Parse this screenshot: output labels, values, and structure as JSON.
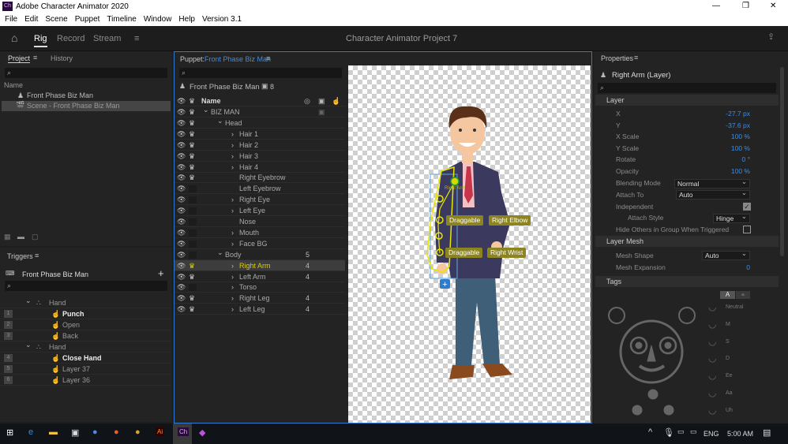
{
  "window": {
    "app_icon": "Ch",
    "title": "Adobe Character Animator 2020",
    "minimize": "—",
    "maximize": "❐",
    "close": "✕"
  },
  "menu": [
    "File",
    "Edit",
    "Scene",
    "Puppet",
    "Timeline",
    "Window",
    "Help",
    "Version 3.1"
  ],
  "header": {
    "workspaces": [
      "Rig",
      "Record",
      "Stream"
    ],
    "active": "Rig",
    "project_title": "Character Animator Project 7"
  },
  "project": {
    "tabs": [
      "Project",
      "History"
    ],
    "column": "Name",
    "items": [
      "Front Phase Biz Man",
      "Scene - Front Phase Biz Man"
    ]
  },
  "triggers": {
    "title": "Triggers",
    "puppet": "Front Phase Biz Man",
    "add": "+",
    "groups": [
      {
        "name": "Hand",
        "items": [
          {
            "key": "1",
            "label": "Punch",
            "active": true
          },
          {
            "key": "2",
            "label": "Open"
          },
          {
            "key": "3",
            "label": "Back"
          }
        ]
      },
      {
        "name": "Hand",
        "items": [
          {
            "key": "4",
            "label": "Close Hand",
            "active": true
          },
          {
            "key": "5",
            "label": "Layer 37"
          },
          {
            "key": "6",
            "label": "Layer 36"
          }
        ]
      }
    ]
  },
  "puppet": {
    "label": "Puppet:",
    "name": "Front Phase Biz Man",
    "title": "Front Phase Biz Man",
    "camera_count": "8",
    "column": "Name",
    "layers": [
      {
        "name": "BIZ MAN",
        "depth": 0,
        "open": true,
        "crown": true,
        "count": ""
      },
      {
        "name": "Head",
        "depth": 1,
        "open": true,
        "crown": true,
        "count": ""
      },
      {
        "name": "Hair 1",
        "depth": 2,
        "closed": true,
        "crown": true,
        "count": ""
      },
      {
        "name": "Hair 2",
        "depth": 2,
        "closed": true,
        "crown": true,
        "count": ""
      },
      {
        "name": "Hair 3",
        "depth": 2,
        "closed": true,
        "crown": true,
        "count": ""
      },
      {
        "name": "Hair 4",
        "depth": 2,
        "closed": true,
        "crown": true,
        "count": ""
      },
      {
        "name": "Right Eyebrow",
        "depth": 2,
        "crown": true,
        "count": ""
      },
      {
        "name": "Left Eyebrow",
        "depth": 2,
        "count": ""
      },
      {
        "name": "Right Eye",
        "depth": 2,
        "closed": true,
        "count": ""
      },
      {
        "name": "Left Eye",
        "depth": 2,
        "closed": true,
        "count": ""
      },
      {
        "name": "Nose",
        "depth": 2,
        "count": ""
      },
      {
        "name": "Mouth",
        "depth": 2,
        "closed": true,
        "count": ""
      },
      {
        "name": "Face BG",
        "depth": 2,
        "closed": true,
        "count": ""
      },
      {
        "name": "Body",
        "depth": 1,
        "open": true,
        "count": "5"
      },
      {
        "name": "Right Arm",
        "depth": 2,
        "closed": true,
        "crown": true,
        "count": "4",
        "selected": true
      },
      {
        "name": "Left Arm",
        "depth": 2,
        "closed": true,
        "crown": true,
        "count": "4"
      },
      {
        "name": "Torso",
        "depth": 2,
        "closed": true,
        "count": ""
      },
      {
        "name": "Right Leg",
        "depth": 2,
        "closed": true,
        "crown": true,
        "count": "4"
      },
      {
        "name": "Left Leg",
        "depth": 2,
        "closed": true,
        "crown": true,
        "count": "4"
      }
    ]
  },
  "canvas": {
    "handle_label": "Right Arm",
    "tags": [
      "Draggable",
      "Right Elbow",
      "Draggable",
      "Right Wrist"
    ]
  },
  "properties": {
    "title": "Properties",
    "layer_title": "Right Arm (Layer)",
    "sections": [
      "Layer",
      "Layer Mesh",
      "Tags"
    ],
    "layer": [
      {
        "label": "X",
        "value": "-27.7 px"
      },
      {
        "label": "Y",
        "value": "-37.6 px"
      },
      {
        "label": "X Scale",
        "value": "100 %"
      },
      {
        "label": "Y Scale",
        "value": "100 %"
      },
      {
        "label": "Rotate",
        "value": "0 °"
      },
      {
        "label": "Opacity",
        "value": "100 %"
      }
    ],
    "blending_mode": {
      "label": "Blending Mode",
      "value": "Normal"
    },
    "attach_to": {
      "label": "Attach To",
      "value": "Auto"
    },
    "independent": {
      "label": "Independent",
      "checked": true
    },
    "attach_style": {
      "label": "Attach Style",
      "value": "Hinge"
    },
    "hide_others": {
      "label": "Hide Others in Group When Triggered",
      "checked": false
    },
    "mesh_shape": {
      "label": "Mesh Shape",
      "value": "Auto"
    },
    "mesh_expansion": {
      "label": "Mesh Expansion",
      "value": "0"
    },
    "tags_toggle": [
      "A",
      "⍨"
    ],
    "visemes": [
      "Neutral",
      "M",
      "S",
      "D",
      "Ee",
      "Aa",
      "Uh"
    ]
  },
  "taskbar": {
    "language": "ENG",
    "time": "5:00 AM"
  },
  "colors": {
    "accent_blue": "#3b8ee6",
    "selection_yellow": "#c9c22a",
    "tag_bg": "#8b8420"
  }
}
